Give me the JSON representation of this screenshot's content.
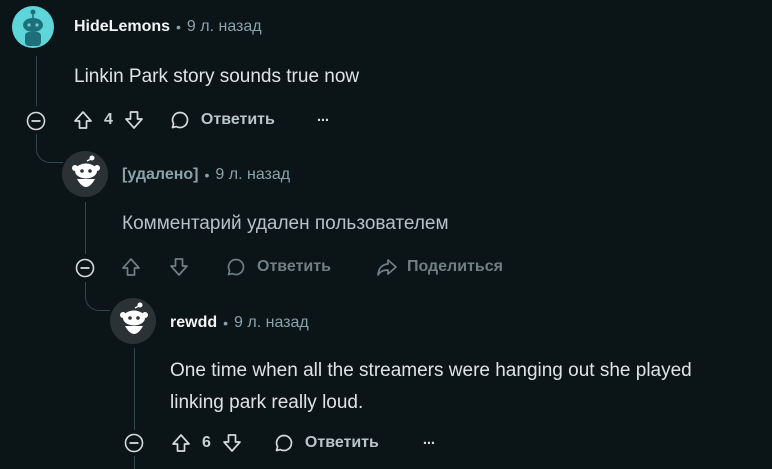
{
  "comments": [
    {
      "author": "HideLemons",
      "time": "9 л. назад",
      "body": "Linkin Park story sounds true now",
      "score": "4",
      "reply_label": "Ответить",
      "more_label": "···"
    },
    {
      "author": "[удалено]",
      "time": "9 л. назад",
      "body": "Комментарий удален пользователем",
      "reply_label": "Ответить",
      "share_label": "Поделиться"
    },
    {
      "author": "rewdd",
      "time": "9 л. назад",
      "body_lines": [
        "One time when all the streamers were hanging out she played",
        "linking park really loud."
      ],
      "score": "6",
      "reply_label": "Ответить",
      "more_label": "···"
    }
  ],
  "separator": "•",
  "colors": {
    "background": "#0b1416",
    "thread_line": "#33464c",
    "avatar_cyan": "#5ed6d9",
    "avatar_dark": "#2a3236"
  },
  "icons": [
    "collapse-icon",
    "upvote-icon",
    "downvote-icon",
    "comment-icon",
    "share-icon",
    "more-icon",
    "avatar-icon"
  ]
}
